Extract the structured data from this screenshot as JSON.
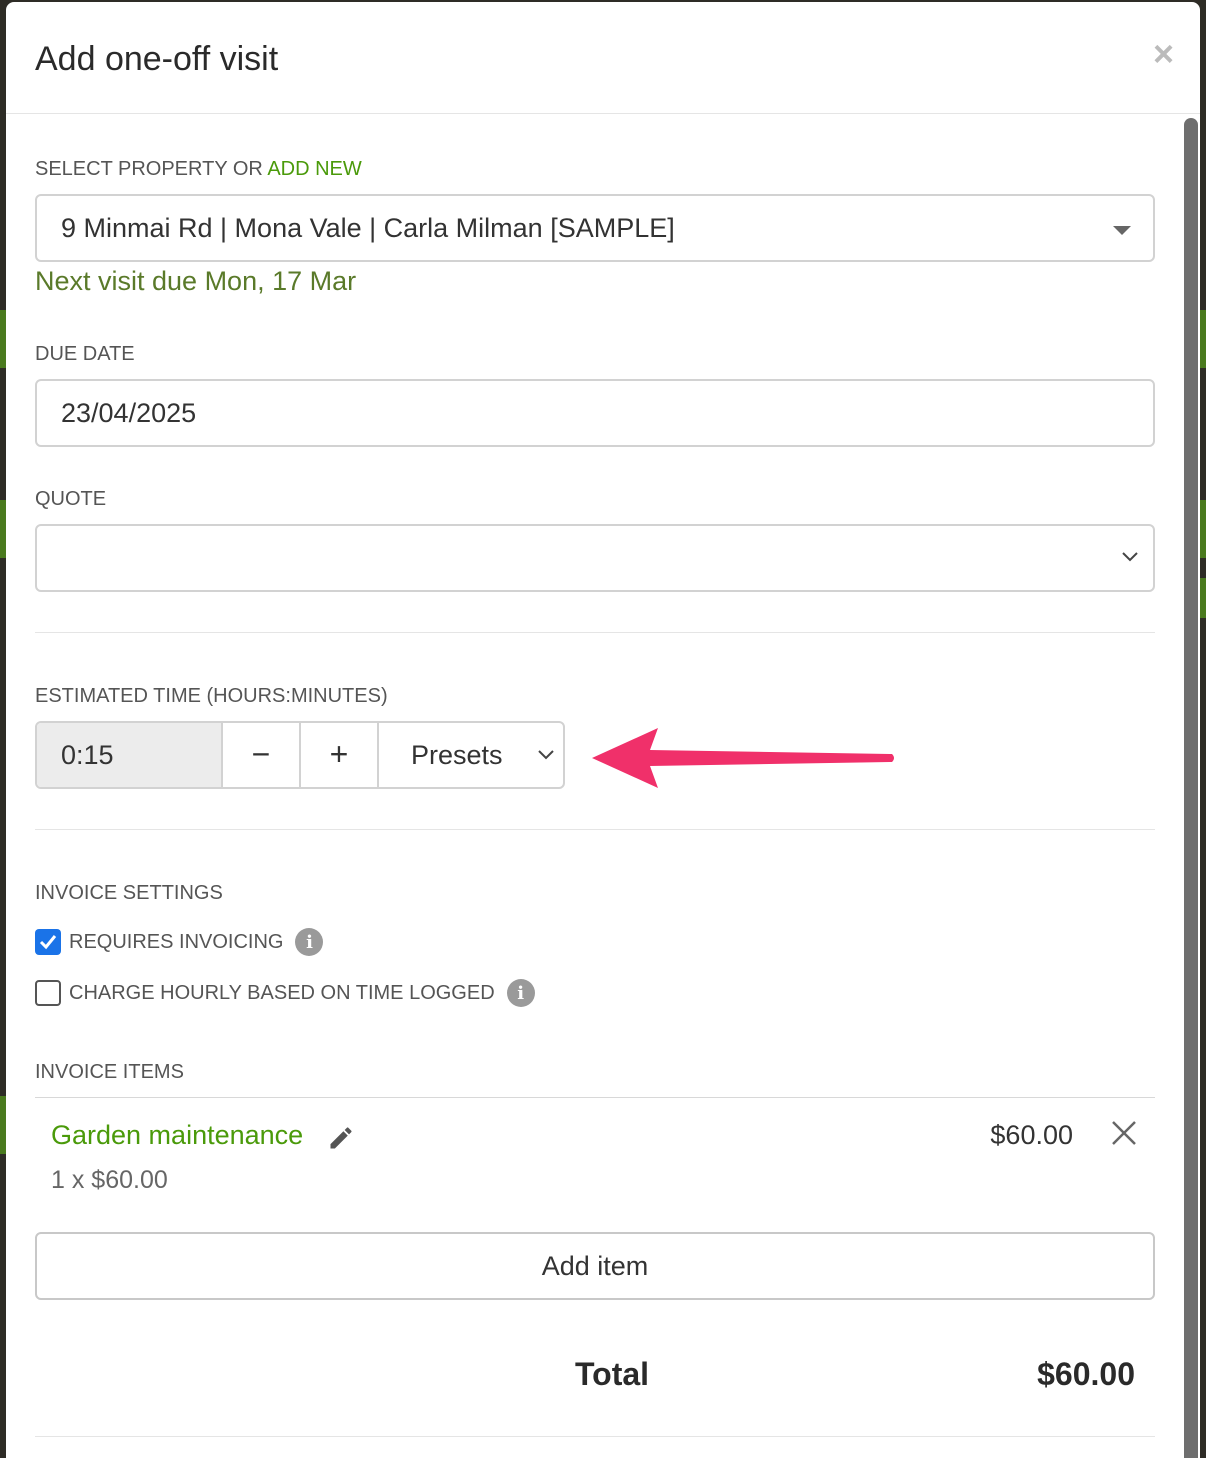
{
  "modal": {
    "title": "Add one-off visit",
    "close_label": "×"
  },
  "property": {
    "label_prefix": "SELECT PROPERTY OR ",
    "label_link": "ADD NEW",
    "selected": "9 Minmai Rd | Mona Vale | Carla Milman [SAMPLE]",
    "hint": "Next visit due Mon, 17 Mar"
  },
  "due_date": {
    "label": "DUE DATE",
    "value": "23/04/2025"
  },
  "quote": {
    "label": "QUOTE",
    "value": ""
  },
  "estimated_time": {
    "label": "ESTIMATED TIME (HOURS:MINUTES)",
    "value": "0:15",
    "minus": "−",
    "plus": "+",
    "presets": "Presets"
  },
  "invoice_settings": {
    "label": "INVOICE SETTINGS",
    "requires_invoicing": {
      "label": "REQUIRES INVOICING",
      "checked": true
    },
    "charge_hourly": {
      "label": "CHARGE HOURLY BASED ON TIME LOGGED",
      "checked": false
    },
    "info_glyph": "i"
  },
  "invoice_items": {
    "label": "INVOICE ITEMS",
    "items": [
      {
        "name": "Garden maintenance",
        "detail": "1 x $60.00",
        "price": "$60.00"
      }
    ],
    "add_label": "Add item"
  },
  "total": {
    "label": "Total",
    "value": "$60.00"
  },
  "colors": {
    "accent_green": "#4a9a0a",
    "hint_green": "#5a7a2a",
    "checkbox_blue": "#1a73e8",
    "annotation_pink": "#f0306a"
  }
}
